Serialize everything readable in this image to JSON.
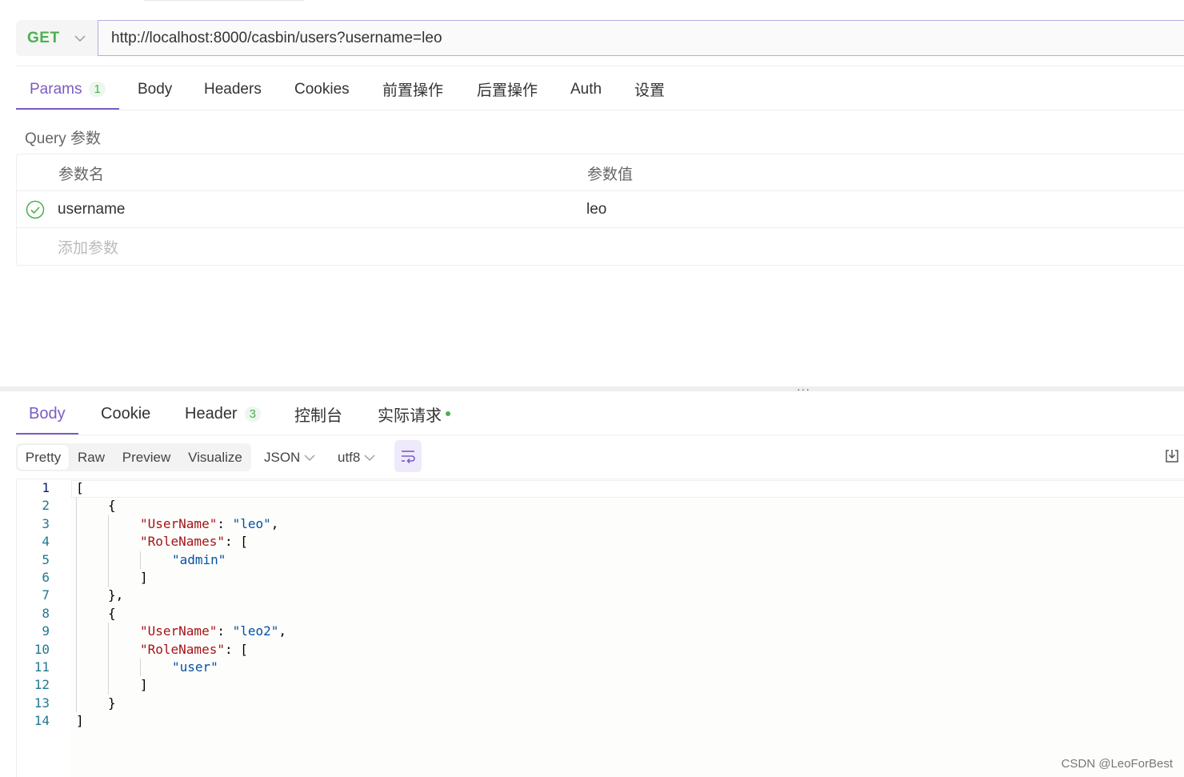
{
  "request": {
    "method": "GET",
    "url": "http://localhost:8000/casbin/users?username=leo"
  },
  "request_tabs": [
    {
      "label": "Params",
      "badge": "1"
    },
    {
      "label": "Body"
    },
    {
      "label": "Headers"
    },
    {
      "label": "Cookies"
    },
    {
      "label": "前置操作"
    },
    {
      "label": "后置操作"
    },
    {
      "label": "Auth"
    },
    {
      "label": "设置"
    }
  ],
  "params": {
    "section_label": "Query 参数",
    "col_name": "参数名",
    "col_value": "参数值",
    "rows": [
      {
        "name": "username",
        "value": "leo",
        "enabled": true
      }
    ],
    "add_placeholder": "添加参数"
  },
  "response_tabs": [
    {
      "label": "Body"
    },
    {
      "label": "Cookie"
    },
    {
      "label": "Header",
      "badge": "3"
    },
    {
      "label": "控制台"
    },
    {
      "label": "实际请求"
    }
  ],
  "view_modes": [
    "Pretty",
    "Raw",
    "Preview",
    "Visualize"
  ],
  "format_select": "JSON",
  "encoding_select": "utf8",
  "code": {
    "line_numbers": [
      "1",
      "2",
      "3",
      "4",
      "5",
      "6",
      "7",
      "8",
      "9",
      "10",
      "11",
      "12",
      "13",
      "14"
    ],
    "open_bracket": "[",
    "close_bracket": "]",
    "open_brace": "{",
    "close_brace_comma": "},",
    "close_brace": "}",
    "key_username": "\"UserName\"",
    "key_rolenames": "\"RoleNames\"",
    "colon": ": ",
    "colon_bracket": ": [",
    "comma": ",",
    "value_user1": "\"leo\"",
    "value_role1": "\"admin\"",
    "value_user2": "\"leo2\"",
    "value_role2": "\"user\""
  },
  "watermark": "CSDN @LeoForBest",
  "colors": {
    "accent": "#7b5cc4",
    "method_get": "#4caf50",
    "json_key": "#a31515",
    "json_string": "#0451a5"
  }
}
